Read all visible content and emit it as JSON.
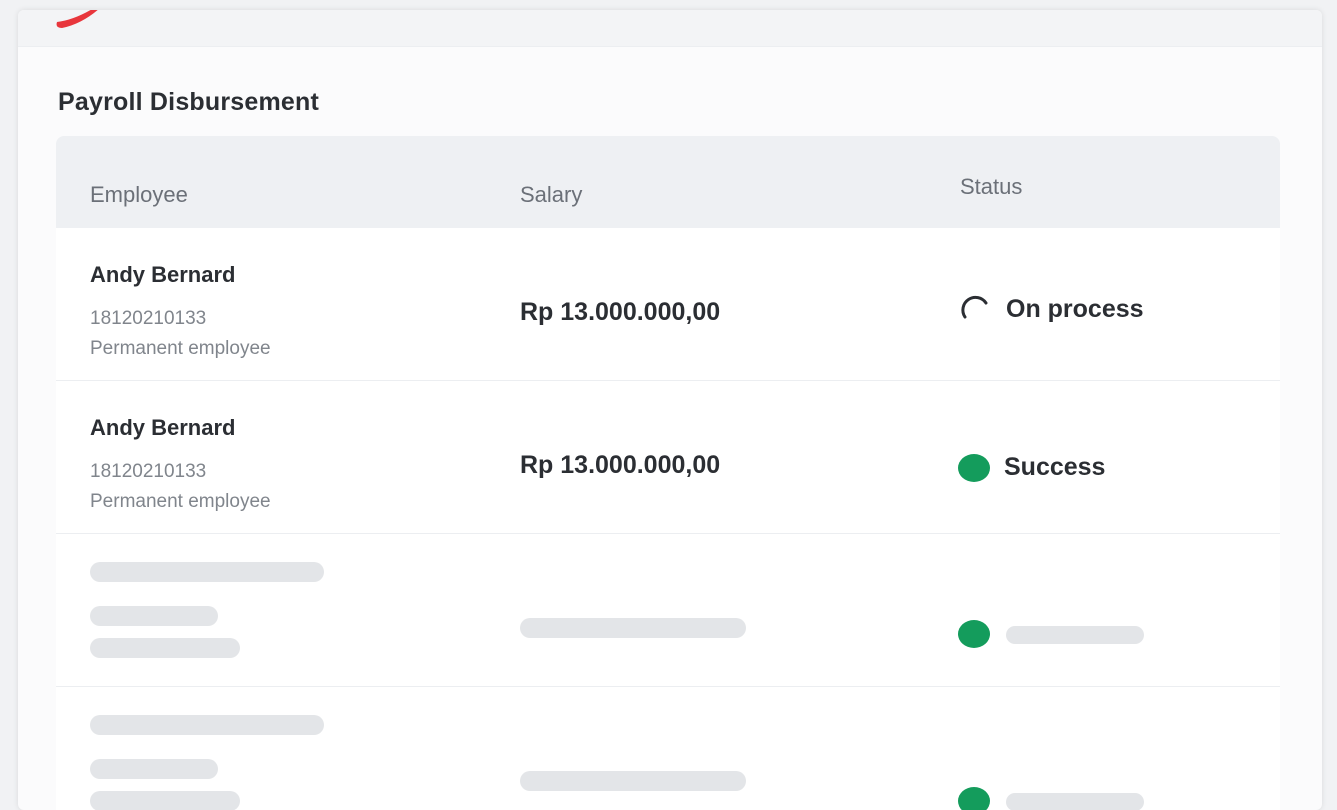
{
  "page": {
    "title": "Payroll Disbursement"
  },
  "colors": {
    "brand": "#e8363c",
    "success": "#149c5c"
  },
  "table": {
    "columns": [
      "Employee",
      "Salary",
      "Status"
    ],
    "rows": [
      {
        "name": "Andy Bernard",
        "id": "18120210133",
        "type": "Permanent employee",
        "salary": "Rp 13.000.000,00",
        "status": "On process",
        "status_icon": "spinner-icon"
      },
      {
        "name": "Andy Bernard",
        "id": "18120210133",
        "type": "Permanent employee",
        "salary": "Rp 13.000.000,00",
        "status": "Success",
        "status_icon": "green-dot-icon"
      }
    ],
    "placeholder_rows": 2
  }
}
